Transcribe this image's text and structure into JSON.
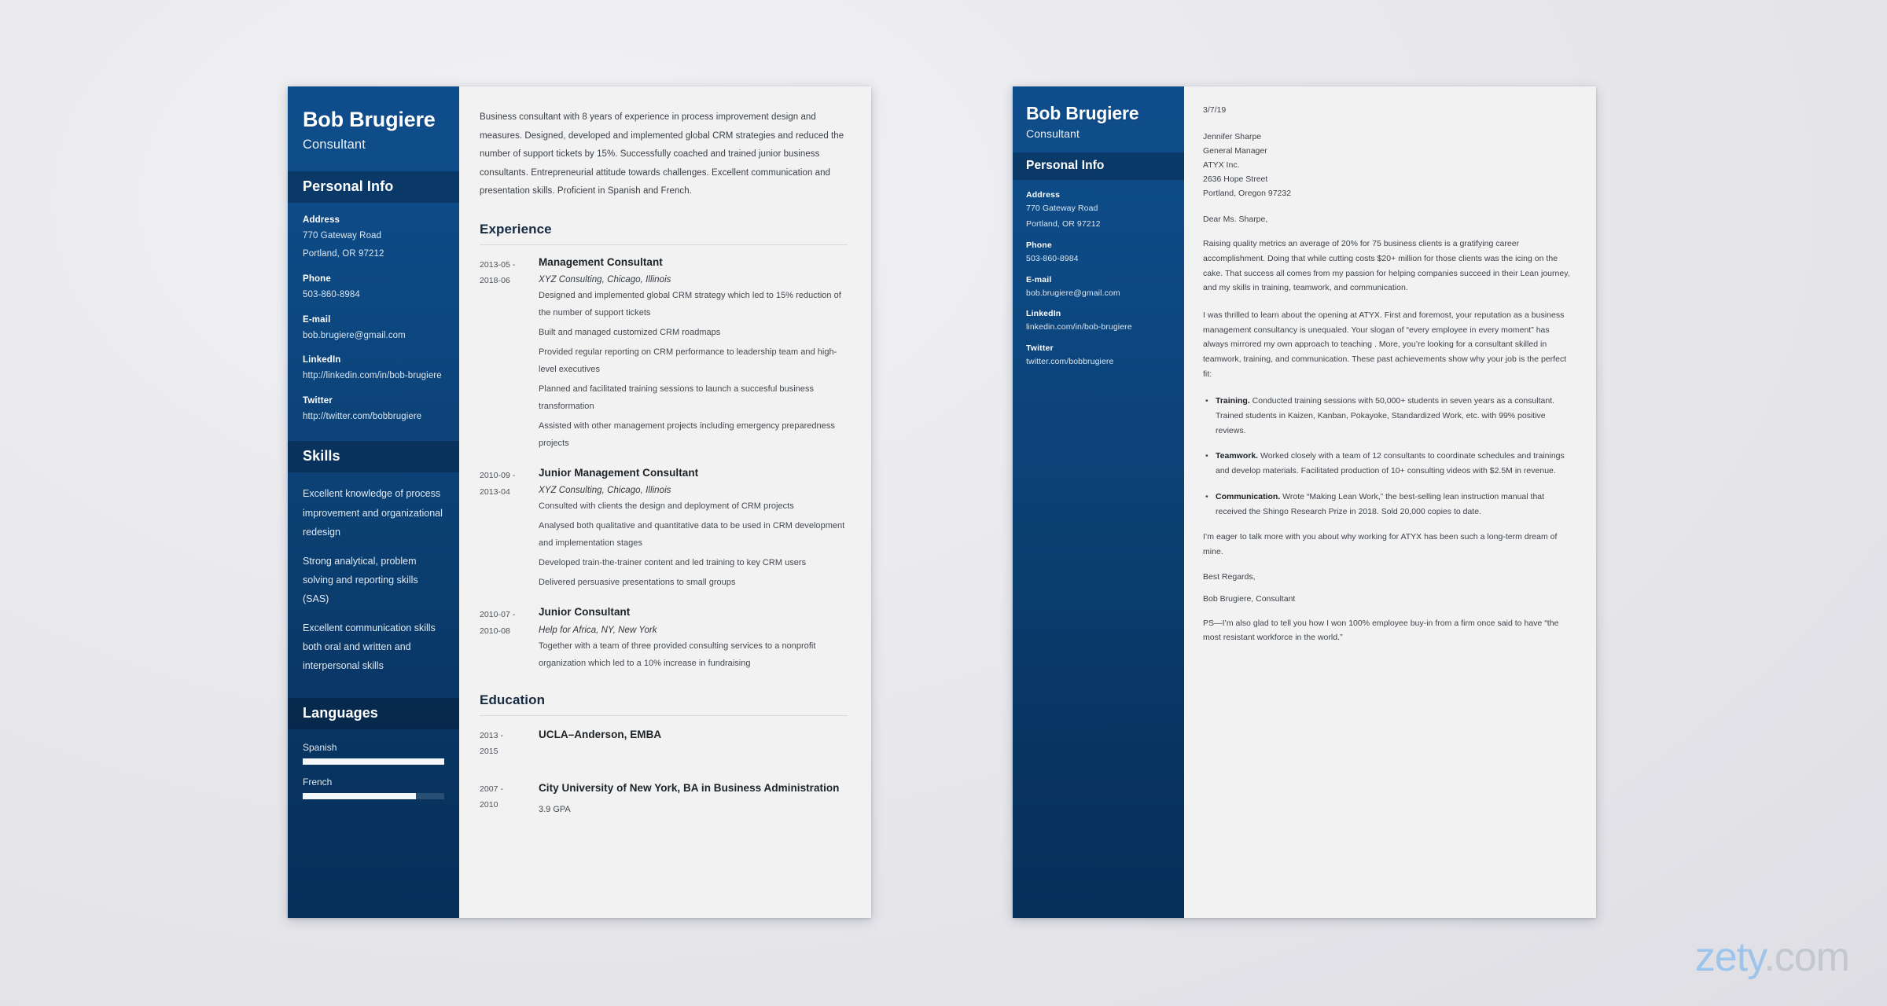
{
  "resume": {
    "sidebar": {
      "name": "Bob Brugiere",
      "role": "Consultant",
      "personal_info_heading": "Personal Info",
      "contacts": [
        {
          "label": "Address",
          "line1": "770 Gateway Road",
          "line2": "Portland, OR 97212"
        },
        {
          "label": "Phone",
          "line1": "503-860-8984",
          "line2": ""
        },
        {
          "label": "E-mail",
          "line1": "bob.brugiere@gmail.com",
          "line2": ""
        },
        {
          "label": "LinkedIn",
          "line1": "http://linkedin.com/in/bob-brugiere",
          "line2": ""
        },
        {
          "label": "Twitter",
          "line1": "http://twitter.com/bobbrugiere",
          "line2": ""
        }
      ],
      "skills_heading": "Skills",
      "skills": [
        "Excellent knowledge of process improvement and organizational redesign",
        "Strong analytical, problem solving and reporting skills (SAS)",
        "Excellent communication skills both oral and written and interpersonal skills"
      ],
      "languages_heading": "Languages",
      "languages": [
        {
          "name": "Spanish",
          "level_percent": 100
        },
        {
          "name": "French",
          "level_percent": 80
        }
      ]
    },
    "summary": "Business consultant with 8 years of experience in process improvement design and measures. Designed, developed and implemented global CRM strategies and reduced the number of support tickets by 15%. Successfully coached and trained junior business consultants. Entrepreneurial attitude towards challenges. Excellent communication and presentation skills. Proficient in Spanish and French.",
    "experience_heading": "Experience",
    "experience": [
      {
        "date_from": "2013-05 -",
        "date_to": "2018-06",
        "title": "Management Consultant",
        "org": "XYZ Consulting, Chicago, Illinois",
        "bullets": [
          "Designed and implemented global CRM strategy which led to 15% reduction of the number of support tickets",
          "Built and managed customized CRM roadmaps",
          "Provided regular reporting on CRM performance to leadership team and high-level executives",
          "Planned and facilitated training sessions to launch a succesful business transformation",
          "Assisted with other management projects including emergency preparedness projects"
        ]
      },
      {
        "date_from": "2010-09 -",
        "date_to": "2013-04",
        "title": "Junior Management Consultant",
        "org": "XYZ Consulting, Chicago, Illinois",
        "bullets": [
          "Consulted with clients the design and deployment of CRM projects",
          "Analysed both qualitative and quantitative data to be used in CRM development and implementation stages",
          "Developed train-the-trainer content and led training to key CRM users",
          "Delivered persuasive presentations to small groups"
        ]
      },
      {
        "date_from": "2010-07 -",
        "date_to": "2010-08",
        "title": "Junior Consultant",
        "org": "Help for Africa, NY, New York",
        "bullets": [
          "Together with a team of three provided consulting services to a nonprofit organization which led to a 10% increase in fundraising"
        ]
      }
    ],
    "education_heading": "Education",
    "education": [
      {
        "date_from": "2013 -",
        "date_to": "2015",
        "title": "UCLA–Anderson, EMBA",
        "note": ""
      },
      {
        "date_from": "2007 -",
        "date_to": "2010",
        "title": "City University of New York, BA in Business Administration",
        "note": "3.9 GPA"
      }
    ]
  },
  "letter": {
    "sidebar": {
      "name": "Bob Brugiere",
      "role": "Consultant",
      "personal_info_heading": "Personal Info",
      "contacts": [
        {
          "label": "Address",
          "line1": "770 Gateway Road",
          "line2": "Portland, OR 97212"
        },
        {
          "label": "Phone",
          "line1": "503-860-8984",
          "line2": ""
        },
        {
          "label": "E-mail",
          "line1": "bob.brugiere@gmail.com",
          "line2": ""
        },
        {
          "label": "LinkedIn",
          "line1": "linkedin.com/in/bob-brugiere",
          "line2": ""
        },
        {
          "label": "Twitter",
          "line1": "twitter.com/bobbrugiere",
          "line2": ""
        }
      ]
    },
    "date": "3/7/19",
    "recipient": [
      "Jennifer Sharpe",
      "General Manager",
      "ATYX Inc.",
      "2636 Hope Street",
      "Portland, Oregon 97232"
    ],
    "greeting": "Dear Ms. Sharpe,",
    "paragraph_1": "Raising quality metrics an average of 20% for 75 business clients is a gratifying career accomplishment. Doing that while cutting costs $20+ million for those clients was the icing on the cake. That success all comes from my passion for helping companies succeed in their Lean journey, and my skills in training, teamwork, and communication.",
    "paragraph_2": "I was thrilled to learn about the opening at ATYX. First and foremost, your reputation as a business management consultancy is unequaled. Your slogan of “every employee in every moment” has always mirrored my own approach to teaching . More, you’re looking for a consultant skilled in teamwork, training, and communication. These past achievements show why your job is the perfect fit:",
    "bullets": [
      {
        "lead": "Training.",
        "text": " Conducted training sessions with 50,000+ students in seven years as a consultant. Trained students in Kaizen, Kanban, Pokayoke, Standardized Work, etc. with 99% positive reviews."
      },
      {
        "lead": "Teamwork.",
        "text": " Worked closely with a team of 12 consultants to coordinate schedules and trainings and develop materials. Facilitated production of 10+ consulting videos with $2.5M in revenue."
      },
      {
        "lead": "Communication.",
        "text": " Wrote “Making Lean Work,” the best-selling lean instruction manual that received the Shingo Research Prize in 2018. Sold 20,000 copies to date."
      }
    ],
    "paragraph_3": "I’m eager to talk more with you about why working for ATYX has been such a long-term dream of mine.",
    "closing": "Best Regards,",
    "signature": "Bob Brugiere, Consultant",
    "postscript": "PS—I’m also glad to tell you how I won 100% employee buy-in from a firm once said to have “the most resistant workforce in the world.”"
  },
  "watermark": {
    "brand": "zety",
    "tld": ".com"
  }
}
